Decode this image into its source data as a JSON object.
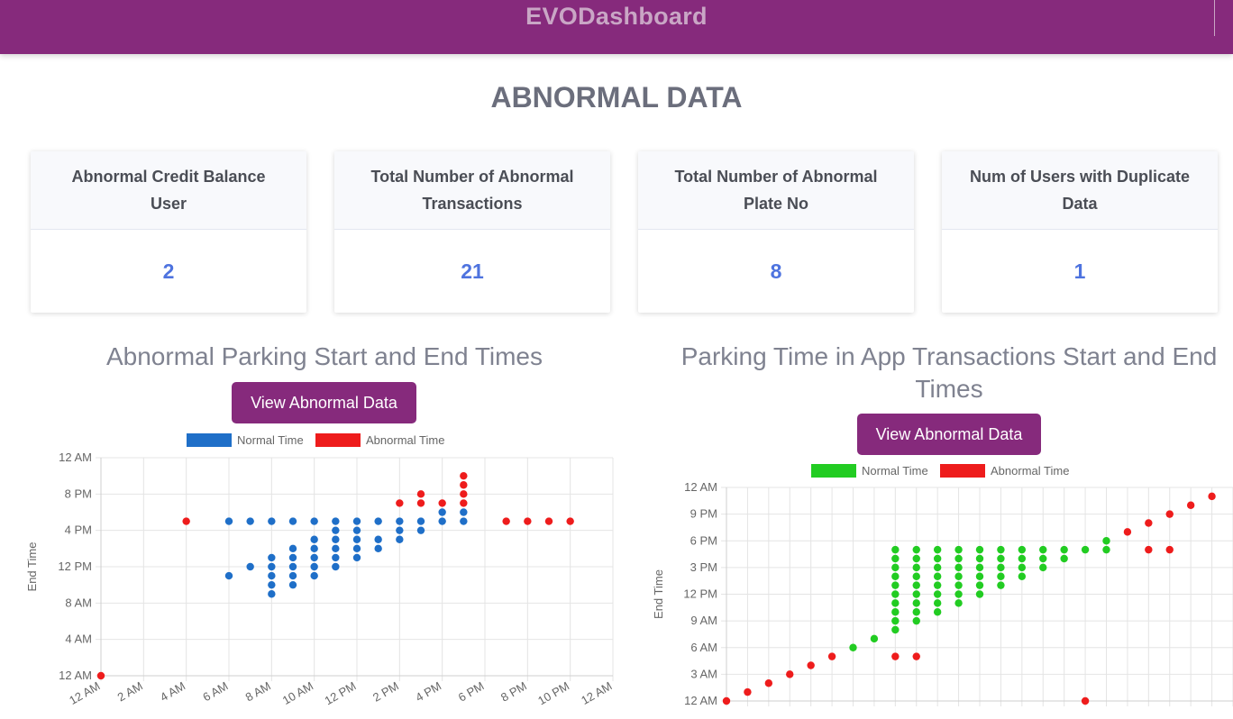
{
  "app": {
    "brand": "EVODashboard"
  },
  "page": {
    "heading": "ABNORMAL DATA"
  },
  "cards": [
    {
      "title": "Abnormal Credit Balance User",
      "value": "2"
    },
    {
      "title": "Total Number of Abnormal Transactions",
      "value": "21"
    },
    {
      "title": "Total Number of Abnormal Plate No",
      "value": "8"
    },
    {
      "title": "Num of Users with Duplicate Data",
      "value": "1"
    }
  ],
  "charts": [
    {
      "title": "Abnormal Parking Start and End Times",
      "button_label": "View Abnormal Data"
    },
    {
      "title": "Parking Time in App Transactions Start and End Times",
      "button_label": "View Abnormal Data"
    }
  ],
  "colors": {
    "brand": "#862a7c",
    "normal_left": "#1f6fc8",
    "normal_right": "#22cc22",
    "abnormal": "#ee1c1c",
    "card_value": "#4e73df"
  },
  "chart_data": [
    {
      "type": "scatter",
      "title": "Abnormal Parking Start and End Times",
      "xlabel": "",
      "ylabel": "End Time",
      "x_unit": "hour of day",
      "y_unit": "hour of day",
      "xlim": [
        0,
        24
      ],
      "ylim": [
        0,
        24
      ],
      "x_ticks": [
        "12 AM",
        "2 AM",
        "4 AM",
        "6 AM",
        "8 AM",
        "10 AM",
        "12 PM",
        "2 PM",
        "4 PM",
        "6 PM",
        "8 PM",
        "10 PM",
        "12 AM"
      ],
      "y_ticks": [
        "12 AM",
        "4 AM",
        "8 AM",
        "12 PM",
        "4 PM",
        "8 PM",
        "12 AM"
      ],
      "grid": true,
      "legend_position": "top",
      "series": [
        {
          "name": "Normal Time",
          "color": "#1f6fc8",
          "points": [
            [
              6,
              11
            ],
            [
              6,
              17
            ],
            [
              7,
              12
            ],
            [
              7,
              17
            ],
            [
              8,
              9
            ],
            [
              8,
              10
            ],
            [
              8,
              11
            ],
            [
              8,
              12
            ],
            [
              8,
              13
            ],
            [
              8,
              17
            ],
            [
              9,
              10
            ],
            [
              9,
              11
            ],
            [
              9,
              12
            ],
            [
              9,
              13
            ],
            [
              9,
              14
            ],
            [
              9,
              17
            ],
            [
              10,
              11
            ],
            [
              10,
              12
            ],
            [
              10,
              13
            ],
            [
              10,
              14
            ],
            [
              10,
              15
            ],
            [
              10,
              17
            ],
            [
              11,
              12
            ],
            [
              11,
              13
            ],
            [
              11,
              14
            ],
            [
              11,
              15
            ],
            [
              11,
              16
            ],
            [
              11,
              17
            ],
            [
              12,
              13
            ],
            [
              12,
              14
            ],
            [
              12,
              15
            ],
            [
              12,
              16
            ],
            [
              12,
              17
            ],
            [
              13,
              14
            ],
            [
              13,
              15
            ],
            [
              13,
              17
            ],
            [
              14,
              15
            ],
            [
              14,
              16
            ],
            [
              14,
              17
            ],
            [
              15,
              16
            ],
            [
              15,
              17
            ],
            [
              16,
              17
            ],
            [
              16,
              18
            ],
            [
              17,
              17
            ],
            [
              17,
              18
            ]
          ]
        },
        {
          "name": "Abnormal Time",
          "color": "#ee1c1c",
          "points": [
            [
              0,
              0
            ],
            [
              4,
              17
            ],
            [
              14,
              19
            ],
            [
              15,
              19
            ],
            [
              15,
              20
            ],
            [
              16,
              19
            ],
            [
              17,
              19
            ],
            [
              17,
              20
            ],
            [
              17,
              21
            ],
            [
              17,
              22
            ],
            [
              19,
              17
            ],
            [
              20,
              17
            ],
            [
              21,
              17
            ],
            [
              22,
              17
            ]
          ]
        }
      ]
    },
    {
      "type": "scatter",
      "title": "Parking Time in App Transactions Start and End Times",
      "xlabel": "",
      "ylabel": "End Time",
      "x_unit": "hour of day",
      "y_unit": "hour of day",
      "ylim": [
        0,
        24
      ],
      "y_ticks": [
        "12 AM",
        "3 AM",
        "6 AM",
        "9 AM",
        "12 PM",
        "3 PM",
        "6 PM",
        "9 PM",
        "12 AM"
      ],
      "grid": true,
      "legend_position": "top",
      "series": [
        {
          "name": "Normal Time",
          "color": "#22cc22",
          "points": [
            [
              6,
              6
            ],
            [
              7,
              7
            ],
            [
              8,
              8
            ],
            [
              8,
              9
            ],
            [
              8,
              10
            ],
            [
              8,
              11
            ],
            [
              8,
              12
            ],
            [
              8,
              13
            ],
            [
              8,
              14
            ],
            [
              8,
              15
            ],
            [
              8,
              16
            ],
            [
              8,
              17
            ],
            [
              9,
              9
            ],
            [
              9,
              10
            ],
            [
              9,
              11
            ],
            [
              9,
              12
            ],
            [
              9,
              13
            ],
            [
              9,
              14
            ],
            [
              9,
              15
            ],
            [
              9,
              16
            ],
            [
              9,
              17
            ],
            [
              10,
              10
            ],
            [
              10,
              11
            ],
            [
              10,
              12
            ],
            [
              10,
              13
            ],
            [
              10,
              14
            ],
            [
              10,
              15
            ],
            [
              10,
              16
            ],
            [
              10,
              17
            ],
            [
              11,
              11
            ],
            [
              11,
              12
            ],
            [
              11,
              13
            ],
            [
              11,
              14
            ],
            [
              11,
              15
            ],
            [
              11,
              16
            ],
            [
              11,
              17
            ],
            [
              12,
              12
            ],
            [
              12,
              13
            ],
            [
              12,
              14
            ],
            [
              12,
              15
            ],
            [
              12,
              16
            ],
            [
              12,
              17
            ],
            [
              13,
              13
            ],
            [
              13,
              14
            ],
            [
              13,
              15
            ],
            [
              13,
              16
            ],
            [
              13,
              17
            ],
            [
              14,
              14
            ],
            [
              14,
              15
            ],
            [
              14,
              16
            ],
            [
              14,
              17
            ],
            [
              15,
              15
            ],
            [
              15,
              16
            ],
            [
              15,
              17
            ],
            [
              16,
              16
            ],
            [
              16,
              17
            ],
            [
              17,
              17
            ],
            [
              18,
              17
            ],
            [
              18,
              18
            ]
          ]
        },
        {
          "name": "Abnormal Time",
          "color": "#ee1c1c",
          "points": [
            [
              0,
              0
            ],
            [
              1,
              1
            ],
            [
              2,
              2
            ],
            [
              3,
              3
            ],
            [
              4,
              4
            ],
            [
              5,
              5
            ],
            [
              8,
              5
            ],
            [
              9,
              5
            ],
            [
              17,
              0
            ],
            [
              19,
              19
            ],
            [
              20,
              20
            ],
            [
              20,
              17
            ],
            [
              21,
              21
            ],
            [
              21,
              17
            ],
            [
              22,
              22
            ],
            [
              23,
              23
            ]
          ]
        }
      ]
    }
  ]
}
